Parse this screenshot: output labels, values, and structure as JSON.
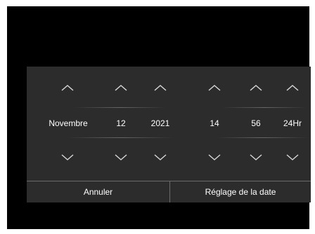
{
  "icons": {
    "up": "chevron-up-icon",
    "down": "chevron-down-icon"
  },
  "colors": {
    "background": "#000000",
    "dialog": "#2c2c2c",
    "text": "#ffffff",
    "chevron": "#d9d9d9",
    "divider": "#6a6a6a"
  },
  "picker": {
    "month": "Novembre",
    "day": "12",
    "year": "2021",
    "hour": "14",
    "minute": "56",
    "format": "24Hr"
  },
  "buttons": {
    "cancel": "Annuler",
    "set_date": "Réglage de la date"
  }
}
